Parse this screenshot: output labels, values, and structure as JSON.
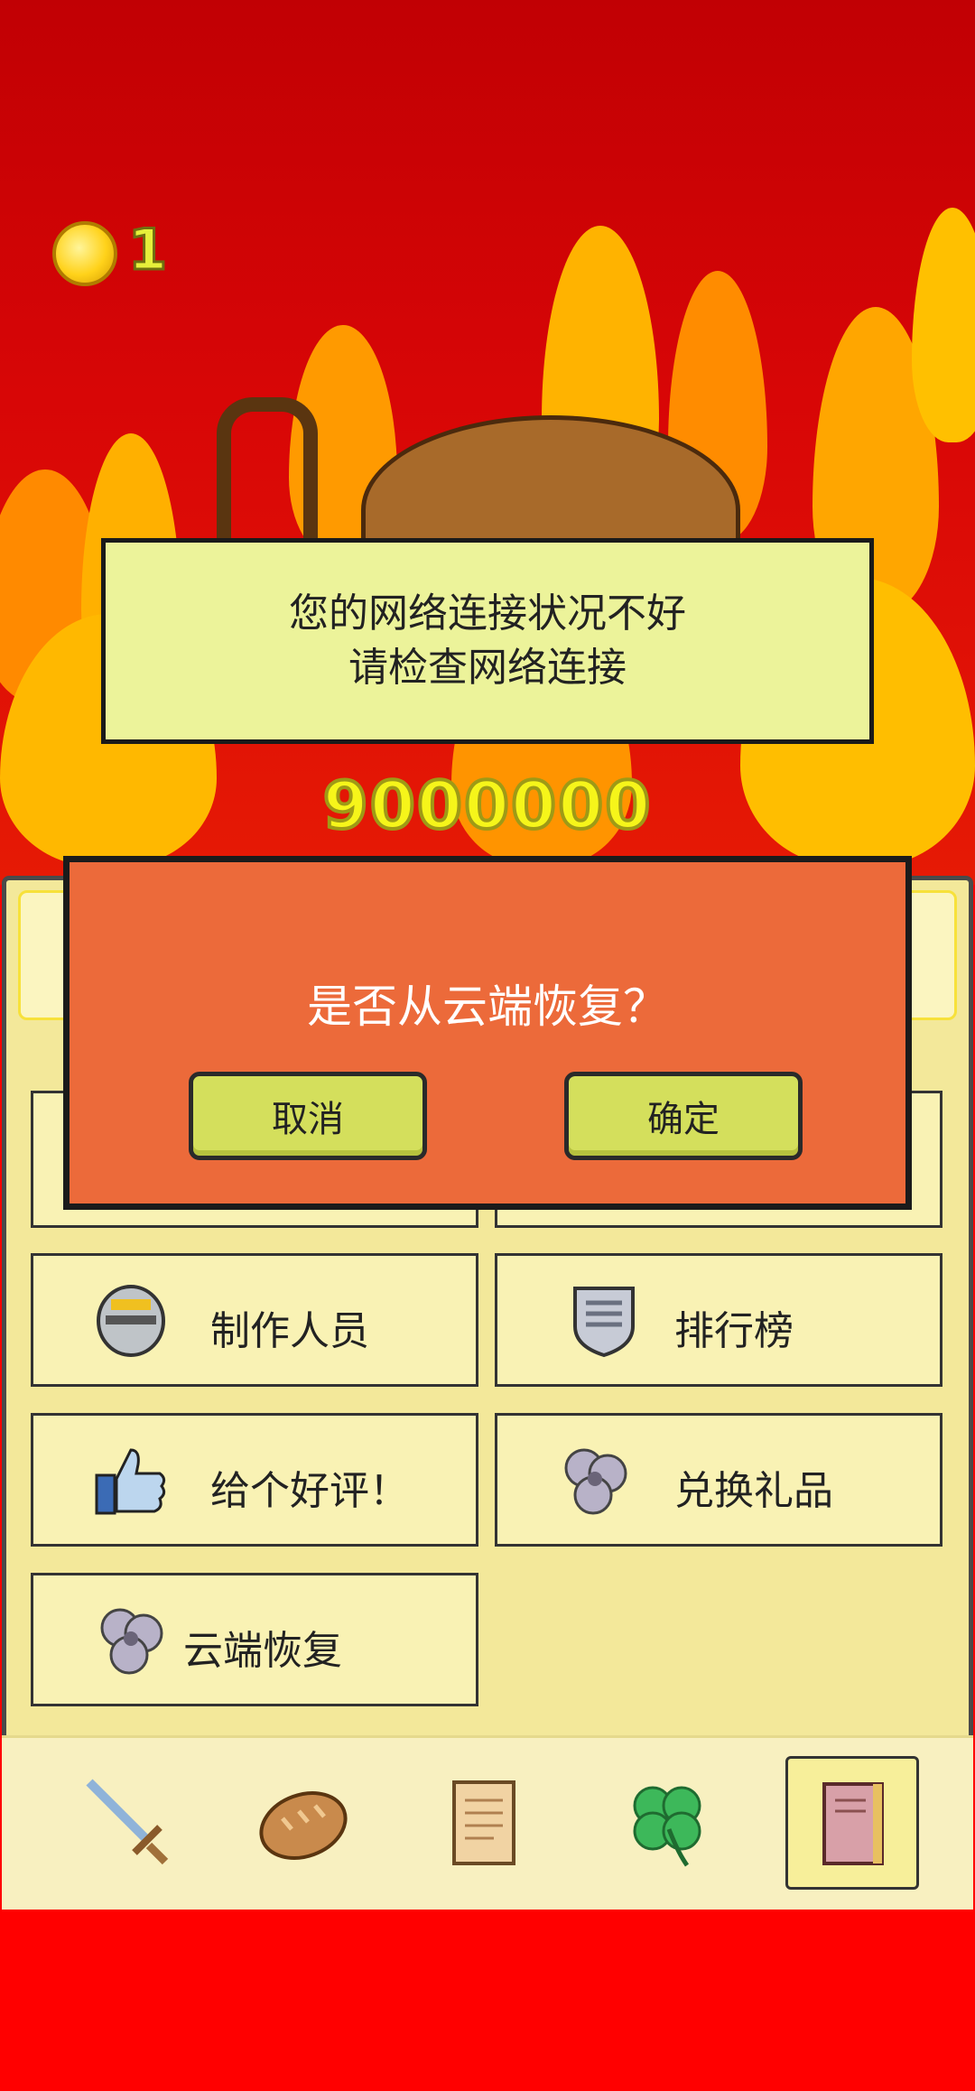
{
  "coins": {
    "count": "1",
    "icon": "gold-coin-icon"
  },
  "network_banner": {
    "line1": "您的网络连接状况不好",
    "line2": "请检查网络连接"
  },
  "score": "9000000",
  "dialog": {
    "question": "是否从云端恢复？",
    "cancel": "取消",
    "confirm": "确定"
  },
  "menu": {
    "credits": {
      "label": "制作人员",
      "icon": "knight-helmet-icon"
    },
    "leaderboard": {
      "label": "排行榜",
      "icon": "shield-icon"
    },
    "rate": {
      "label": "给个好评！",
      "icon": "thumbs-up-icon"
    },
    "redeem": {
      "label": "兑换礼品",
      "icon": "swirl-icon"
    },
    "cloud_restore": {
      "label": "云端恢复",
      "icon": "swirl-icon"
    }
  },
  "tabs": [
    {
      "icon": "sword-icon",
      "active": false
    },
    {
      "icon": "bread-icon",
      "active": false
    },
    {
      "icon": "scroll-icon",
      "active": false
    },
    {
      "icon": "clover-icon",
      "active": false
    },
    {
      "icon": "book-icon",
      "active": true
    }
  ],
  "colors": {
    "fire_red": "#d80606",
    "banner_yellow": "#ecf39a",
    "dialog_orange": "#ec6a3a",
    "button_green": "#d4df5c",
    "panel_cream": "#f3e89a"
  }
}
